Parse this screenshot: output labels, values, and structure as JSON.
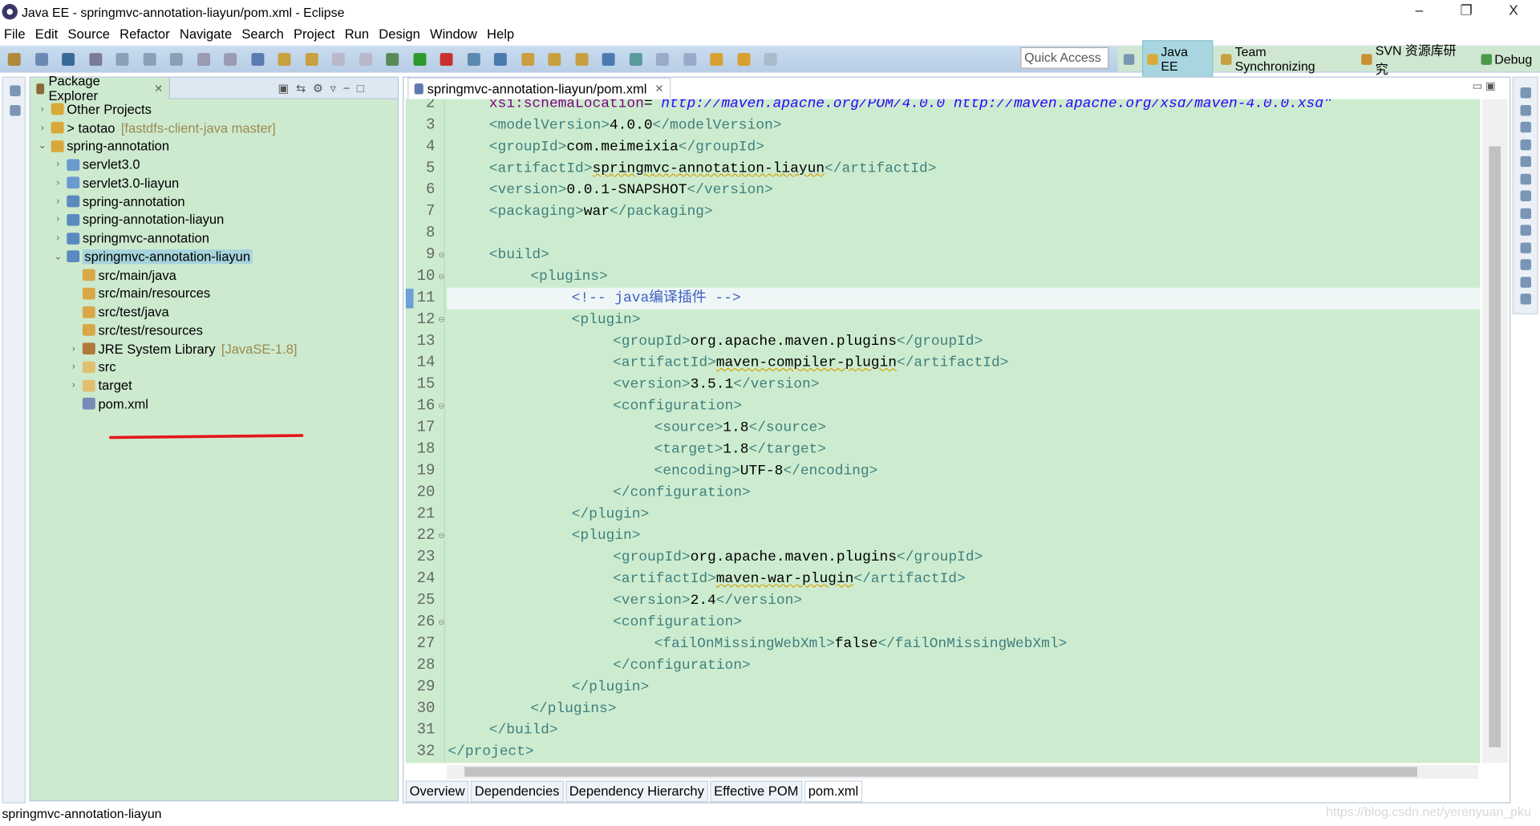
{
  "window": {
    "title": "Java EE - springmvc-annotation-liayun/pom.xml - Eclipse",
    "minimize": "–",
    "maximize": "❐",
    "close": "X"
  },
  "menu": [
    "File",
    "Edit",
    "Source",
    "Refactor",
    "Navigate",
    "Search",
    "Project",
    "Run",
    "Design",
    "Window",
    "Help"
  ],
  "toolbar": {
    "quick_access": "Quick Access"
  },
  "perspectives": [
    {
      "label": "Java EE",
      "active": true,
      "color": "#d9a93a"
    },
    {
      "label": "Team Synchronizing",
      "active": false,
      "color": "#c8a040"
    },
    {
      "label": "SVN 资源库研究",
      "active": false,
      "color": "#c89030"
    },
    {
      "label": "Debug",
      "active": false,
      "color": "#4a9a4a"
    }
  ],
  "package_explorer": {
    "tab": "Package Explorer",
    "items": [
      {
        "label": "Other Projects",
        "level": 0,
        "twisty": "›",
        "icon": "working-set-icon",
        "deco": ""
      },
      {
        "label": "> taotao",
        "level": 0,
        "twisty": "›",
        "icon": "working-set-icon",
        "deco": "[fastdfs-client-java master]"
      },
      {
        "label": "spring-annotation",
        "level": 0,
        "twisty": "⌄",
        "icon": "working-set-icon",
        "deco": ""
      },
      {
        "label": "servlet3.0",
        "level": 1,
        "twisty": "›",
        "icon": "web-project-icon",
        "deco": ""
      },
      {
        "label": "servlet3.0-liayun",
        "level": 1,
        "twisty": "›",
        "icon": "web-project-icon",
        "deco": ""
      },
      {
        "label": "spring-annotation",
        "level": 1,
        "twisty": "›",
        "icon": "maven-project-icon",
        "deco": ""
      },
      {
        "label": "spring-annotation-liayun",
        "level": 1,
        "twisty": "›",
        "icon": "maven-project-icon",
        "deco": ""
      },
      {
        "label": "springmvc-annotation",
        "level": 1,
        "twisty": "›",
        "icon": "maven-project-icon",
        "deco": ""
      },
      {
        "label": "springmvc-annotation-liayun",
        "level": 1,
        "twisty": "⌄",
        "icon": "maven-project-icon",
        "deco": "",
        "selected": true
      },
      {
        "label": "src/main/java",
        "level": 2,
        "twisty": "",
        "icon": "source-folder-icon",
        "deco": ""
      },
      {
        "label": "src/main/resources",
        "level": 2,
        "twisty": "",
        "icon": "source-folder-icon",
        "deco": ""
      },
      {
        "label": "src/test/java",
        "level": 2,
        "twisty": "",
        "icon": "source-folder-icon",
        "deco": ""
      },
      {
        "label": "src/test/resources",
        "level": 2,
        "twisty": "",
        "icon": "source-folder-icon",
        "deco": ""
      },
      {
        "label": "JRE System Library",
        "level": 2,
        "twisty": "›",
        "icon": "library-icon",
        "deco": "[JavaSE-1.8]"
      },
      {
        "label": "src",
        "level": 2,
        "twisty": "›",
        "icon": "folder-icon",
        "deco": ""
      },
      {
        "label": "target",
        "level": 2,
        "twisty": "›",
        "icon": "folder-icon",
        "deco": ""
      },
      {
        "label": "pom.xml",
        "level": 2,
        "twisty": "",
        "icon": "xml-file-icon",
        "deco": ""
      }
    ]
  },
  "editor": {
    "tab": "springmvc-annotation-liayun/pom.xml",
    "current_line": 11,
    "lines": [
      {
        "n": "2",
        "i": 1,
        "p": [
          [
            "attr",
            "xsi:schemaLocation"
          ],
          [
            "txt",
            "= "
          ],
          [
            "val",
            "http://maven.apache.org/POM/4.0.0 http://maven.apache.org/xsd/maven-4.0.0.xsd\""
          ]
        ]
      },
      {
        "n": "3",
        "i": 1,
        "p": [
          [
            "tag",
            "<modelVersion>"
          ],
          [
            "txt",
            "4.0.0"
          ],
          [
            "tag",
            "</modelVersion>"
          ]
        ]
      },
      {
        "n": "4",
        "i": 1,
        "p": [
          [
            "tag",
            "<groupId>"
          ],
          [
            "txt",
            "com.meimeixia"
          ],
          [
            "tag",
            "</groupId>"
          ]
        ]
      },
      {
        "n": "5",
        "i": 1,
        "p": [
          [
            "tag",
            "<artifactId>"
          ],
          [
            "txt sq",
            "springmvc-annotation-liayun"
          ],
          [
            "tag",
            "</artifactId>"
          ]
        ]
      },
      {
        "n": "6",
        "i": 1,
        "p": [
          [
            "tag",
            "<version>"
          ],
          [
            "txt",
            "0.0.1-SNAPSHOT"
          ],
          [
            "tag",
            "</version>"
          ]
        ]
      },
      {
        "n": "7",
        "i": 1,
        "p": [
          [
            "tag",
            "<packaging>"
          ],
          [
            "txt",
            "war"
          ],
          [
            "tag",
            "</packaging>"
          ]
        ]
      },
      {
        "n": "8",
        "i": 0,
        "p": []
      },
      {
        "n": "9",
        "i": 1,
        "f": true,
        "p": [
          [
            "tag",
            "<build>"
          ]
        ]
      },
      {
        "n": "10",
        "i": 2,
        "f": true,
        "p": [
          [
            "tag",
            "<plugins>"
          ]
        ]
      },
      {
        "n": "11",
        "i": 3,
        "p": [
          [
            "cmt",
            "<!-- java编译插件 -->"
          ]
        ]
      },
      {
        "n": "12",
        "i": 3,
        "f": true,
        "p": [
          [
            "tag",
            "<plugin>"
          ]
        ]
      },
      {
        "n": "13",
        "i": 4,
        "p": [
          [
            "tag",
            "<groupId>"
          ],
          [
            "txt",
            "org.apache.maven.plugins"
          ],
          [
            "tag",
            "</groupId>"
          ]
        ]
      },
      {
        "n": "14",
        "i": 4,
        "p": [
          [
            "tag",
            "<artifactId>"
          ],
          [
            "txt sq",
            "maven-compiler-plugin"
          ],
          [
            "tag",
            "</artifactId>"
          ]
        ]
      },
      {
        "n": "15",
        "i": 4,
        "p": [
          [
            "tag",
            "<version>"
          ],
          [
            "txt",
            "3.5.1"
          ],
          [
            "tag",
            "</version>"
          ]
        ]
      },
      {
        "n": "16",
        "i": 4,
        "f": true,
        "p": [
          [
            "tag",
            "<configuration>"
          ]
        ]
      },
      {
        "n": "17",
        "i": 5,
        "p": [
          [
            "tag",
            "<source>"
          ],
          [
            "txt",
            "1.8"
          ],
          [
            "tag",
            "</source>"
          ]
        ]
      },
      {
        "n": "18",
        "i": 5,
        "p": [
          [
            "tag",
            "<target>"
          ],
          [
            "txt",
            "1.8"
          ],
          [
            "tag",
            "</target>"
          ]
        ]
      },
      {
        "n": "19",
        "i": 5,
        "p": [
          [
            "tag",
            "<encoding>"
          ],
          [
            "txt",
            "UTF-8"
          ],
          [
            "tag",
            "</encoding>"
          ]
        ]
      },
      {
        "n": "20",
        "i": 4,
        "p": [
          [
            "tag",
            "</configuration>"
          ]
        ]
      },
      {
        "n": "21",
        "i": 3,
        "p": [
          [
            "tag",
            "</plugin>"
          ]
        ]
      },
      {
        "n": "22",
        "i": 3,
        "f": true,
        "p": [
          [
            "tag",
            "<plugin>"
          ]
        ]
      },
      {
        "n": "23",
        "i": 4,
        "p": [
          [
            "tag",
            "<groupId>"
          ],
          [
            "txt",
            "org.apache.maven.plugins"
          ],
          [
            "tag",
            "</groupId>"
          ]
        ]
      },
      {
        "n": "24",
        "i": 4,
        "p": [
          [
            "tag",
            "<artifactId>"
          ],
          [
            "txt sq",
            "maven-war-plugin"
          ],
          [
            "tag",
            "</artifactId>"
          ]
        ]
      },
      {
        "n": "25",
        "i": 4,
        "p": [
          [
            "tag",
            "<version>"
          ],
          [
            "txt",
            "2.4"
          ],
          [
            "tag",
            "</version>"
          ]
        ]
      },
      {
        "n": "26",
        "i": 4,
        "f": true,
        "p": [
          [
            "tag",
            "<configuration>"
          ]
        ]
      },
      {
        "n": "27",
        "i": 5,
        "p": [
          [
            "tag",
            "<failOnMissingWebXml>"
          ],
          [
            "txt",
            "false"
          ],
          [
            "tag",
            "</failOnMissingWebXml>"
          ]
        ]
      },
      {
        "n": "28",
        "i": 4,
        "p": [
          [
            "tag",
            "</configuration>"
          ]
        ]
      },
      {
        "n": "29",
        "i": 3,
        "p": [
          [
            "tag",
            "</plugin>"
          ]
        ]
      },
      {
        "n": "30",
        "i": 2,
        "p": [
          [
            "tag",
            "</plugins>"
          ]
        ]
      },
      {
        "n": "31",
        "i": 1,
        "p": [
          [
            "tag",
            "</build>"
          ]
        ]
      },
      {
        "n": "32",
        "i": 0,
        "p": [
          [
            "tag",
            "</project>"
          ]
        ]
      }
    ],
    "bottom_tabs": [
      "Overview",
      "Dependencies",
      "Dependency Hierarchy",
      "Effective POM",
      "pom.xml"
    ],
    "active_bottom_tab": "pom.xml"
  },
  "status": {
    "selection": "springmvc-annotation-liayun"
  },
  "watermark": "https://blog.csdn.net/yerenyuan_pku"
}
